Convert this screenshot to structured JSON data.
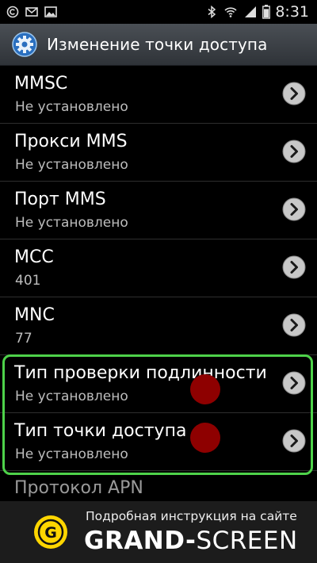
{
  "status_bar": {
    "time": "8:31",
    "left_icons": [
      "copyright-icon",
      "mail-icon",
      "image-icon"
    ],
    "right_icons": [
      "bluetooth-icon",
      "wifi-icon",
      "signal-icon",
      "battery-icon"
    ],
    "battery_level": 0.85
  },
  "header": {
    "title": "Изменение точки доступа",
    "icon": "gear-icon"
  },
  "settings": [
    {
      "label": "MMSC",
      "value": "Не установлено"
    },
    {
      "label": "Прокси MMS",
      "value": "Не установлено"
    },
    {
      "label": "Порт MMS",
      "value": "Не установлено"
    },
    {
      "label": "MCC",
      "value": "401"
    },
    {
      "label": "MNC",
      "value": "77"
    },
    {
      "label": "Тип проверки подлинности",
      "value": "Не установлено"
    },
    {
      "label": "Тип точки доступа",
      "value": "Не установлено"
    }
  ],
  "partial_item": {
    "label": "Протокол APN"
  },
  "banner": {
    "subtitle": "Подробная инструкция на сайте",
    "brand_bold": "GRAND-",
    "brand_regular": "SCREEN",
    "logo_letter": "G"
  },
  "colors": {
    "highlight": "#4ed24a",
    "marker": "#8e0000",
    "logo_yellow": "#ffd600"
  }
}
